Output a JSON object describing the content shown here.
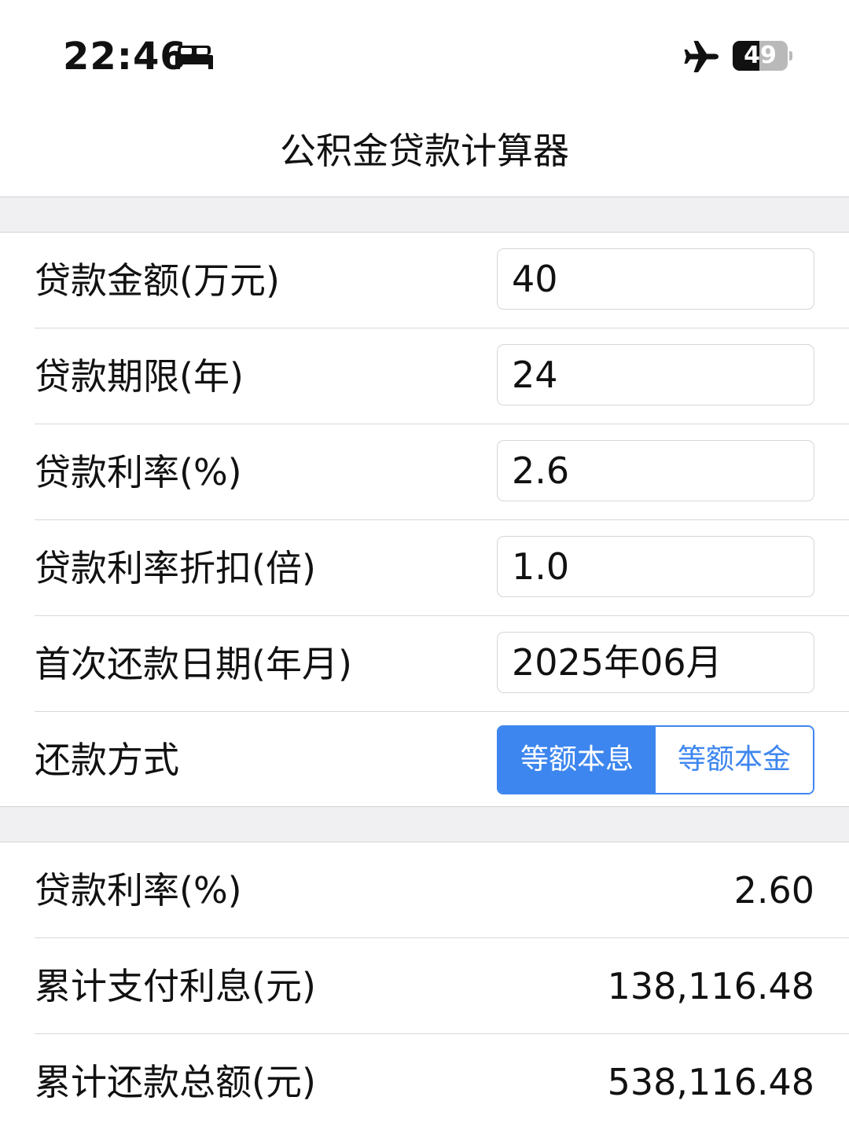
{
  "status_bar": {
    "time": "22:46",
    "battery_level": "49",
    "battery_fraction": 0.49,
    "icons": [
      "bed-icon",
      "airplane-mode-icon",
      "battery-icon"
    ]
  },
  "header": {
    "title": "公积金贷款计算器"
  },
  "form": {
    "loan_amount_label": "贷款金额(万元)",
    "loan_amount_value": "40",
    "loan_term_label": "贷款期限(年)",
    "loan_term_value": "24",
    "interest_rate_label": "贷款利率(%)",
    "interest_rate_value": "2.6",
    "rate_discount_label": "贷款利率折扣(倍)",
    "rate_discount_value": "1.0",
    "first_payment_label": "首次还款日期(年月)",
    "first_payment_value": "2025年06月",
    "repayment_method_label": "还款方式",
    "repayment_options": [
      "等额本息",
      "等额本金"
    ],
    "repayment_selected": "等额本息"
  },
  "results": {
    "rate_label": "贷款利率(%)",
    "rate_value": "2.60",
    "total_interest_label": "累计支付利息(元)",
    "total_interest_value": "138,116.48",
    "total_repayment_label": "累计还款总额(元)",
    "total_repayment_value": "538,116.48"
  },
  "colors": {
    "accent": "#3d86ef",
    "section_gap": "#f0f0f2",
    "separator": "#d8d8dc"
  }
}
